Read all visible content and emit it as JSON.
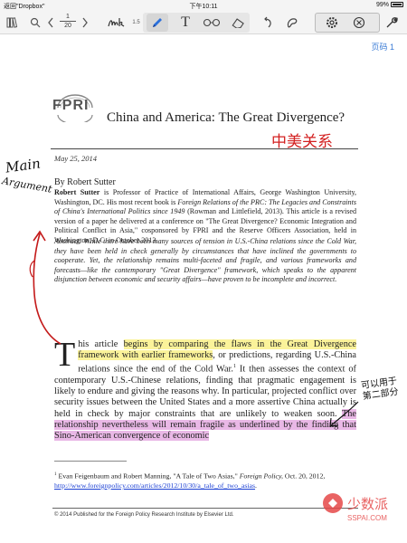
{
  "status": {
    "back_app": "返回\"Dropbox\"",
    "time": "下午10:11",
    "battery": "99%"
  },
  "toolbar": {
    "page_current": "1",
    "page_total": "20",
    "pen_size": "1.5",
    "icons": [
      "library-icon",
      "search-icon",
      "prev-page-icon",
      "next-page-icon",
      "handwriting-icon",
      "pen-icon",
      "text-tool-icon",
      "glasses-icon",
      "eraser-icon",
      "undo-icon",
      "lasso-icon",
      "settings-icon",
      "close-tool-icon",
      "wrench-icon"
    ]
  },
  "page_label": "页码 1",
  "doc": {
    "logo": "FPRI",
    "title": "China and America: The Great Divergence?",
    "red_note": "中美关系",
    "date": "May 25, 2014",
    "author_line": "By Robert Sutter",
    "bio_name": "Robert Sutter",
    "bio_text_1": " is Professor of Practice of International Affairs, George Washington University, Washington, DC. His most recent book is ",
    "bio_book": "Foreign Relations of the PRC: The Legacies and Constraints of China's International Politics since 1949",
    "bio_text_2": " (Rowman and Littlefield, 2013). This article is a revised version of a paper he delivered at a conference on \"The Great Divergence? Economic Integration and Political Conflict in Asia,\" cosponsored by FPRI and the Reserve Officers Association, held in Washington, D.C. in October 2013.",
    "abstract": "Abstract: While there have been many sources of tension in U.S.-China relations since the Cold War, they have been held in check generally by circumstances that have inclined the governments to cooperate. Yet, the relationship remains multi-faceted and fragile, and various frameworks and forecasts—like the contemporary \"Great Divergence\" framework, which speaks to the apparent disjunction between economic and security affairs—have proven to be incomplete and incorrect.",
    "body_dropcap": "T",
    "body_a": "his article ",
    "body_hl_yellow": "begins by comparing the flaws in the Great Divergence framework with earlier frameworks",
    "body_b": ", or predictions, regarding U.S.-China relations since the end of the Cold War.",
    "body_sup": "1",
    "body_c": " It then assesses the context of contemporary U.S.-Chinese relations, finding that pragmatic engagement is likely to endure and giving the reasons why. In particular, projected conflict over security issues between the United States and a more assertive China actually is held in check by major constraints that are unlikely to weaken soon. ",
    "body_hl_pink": "The relationship nevertheless will remain fragile as underlined by the finding that Sino-American convergence of economic",
    "footnote_mark": "1",
    "footnote_text": " Evan Feigenbaum and Robert Manning, \"A Tale of Two Asias,\" ",
    "footnote_journal": "Foreign Policy,",
    "footnote_date": " Oct. 20, 2012, ",
    "footnote_link": "http://www.foreignpolicy.com/articles/2012/10/30/a_tale_of_two_asias",
    "footnote_end": ".",
    "copyright": "© 2014 Published for the Foreign Policy Research Institute by Elsevier Ltd."
  },
  "annotations": {
    "main": "Main",
    "argument": "Argument",
    "side_note": "可以用于 第二部分"
  },
  "watermark": {
    "brand": "少数派",
    "url": "SSPAI.COM"
  },
  "colors": {
    "highlight_yellow": "#fbf39a",
    "highlight_pink": "#e9b8e6",
    "ink_red": "#c41a1a",
    "accent_blue": "#3a7bd5"
  }
}
